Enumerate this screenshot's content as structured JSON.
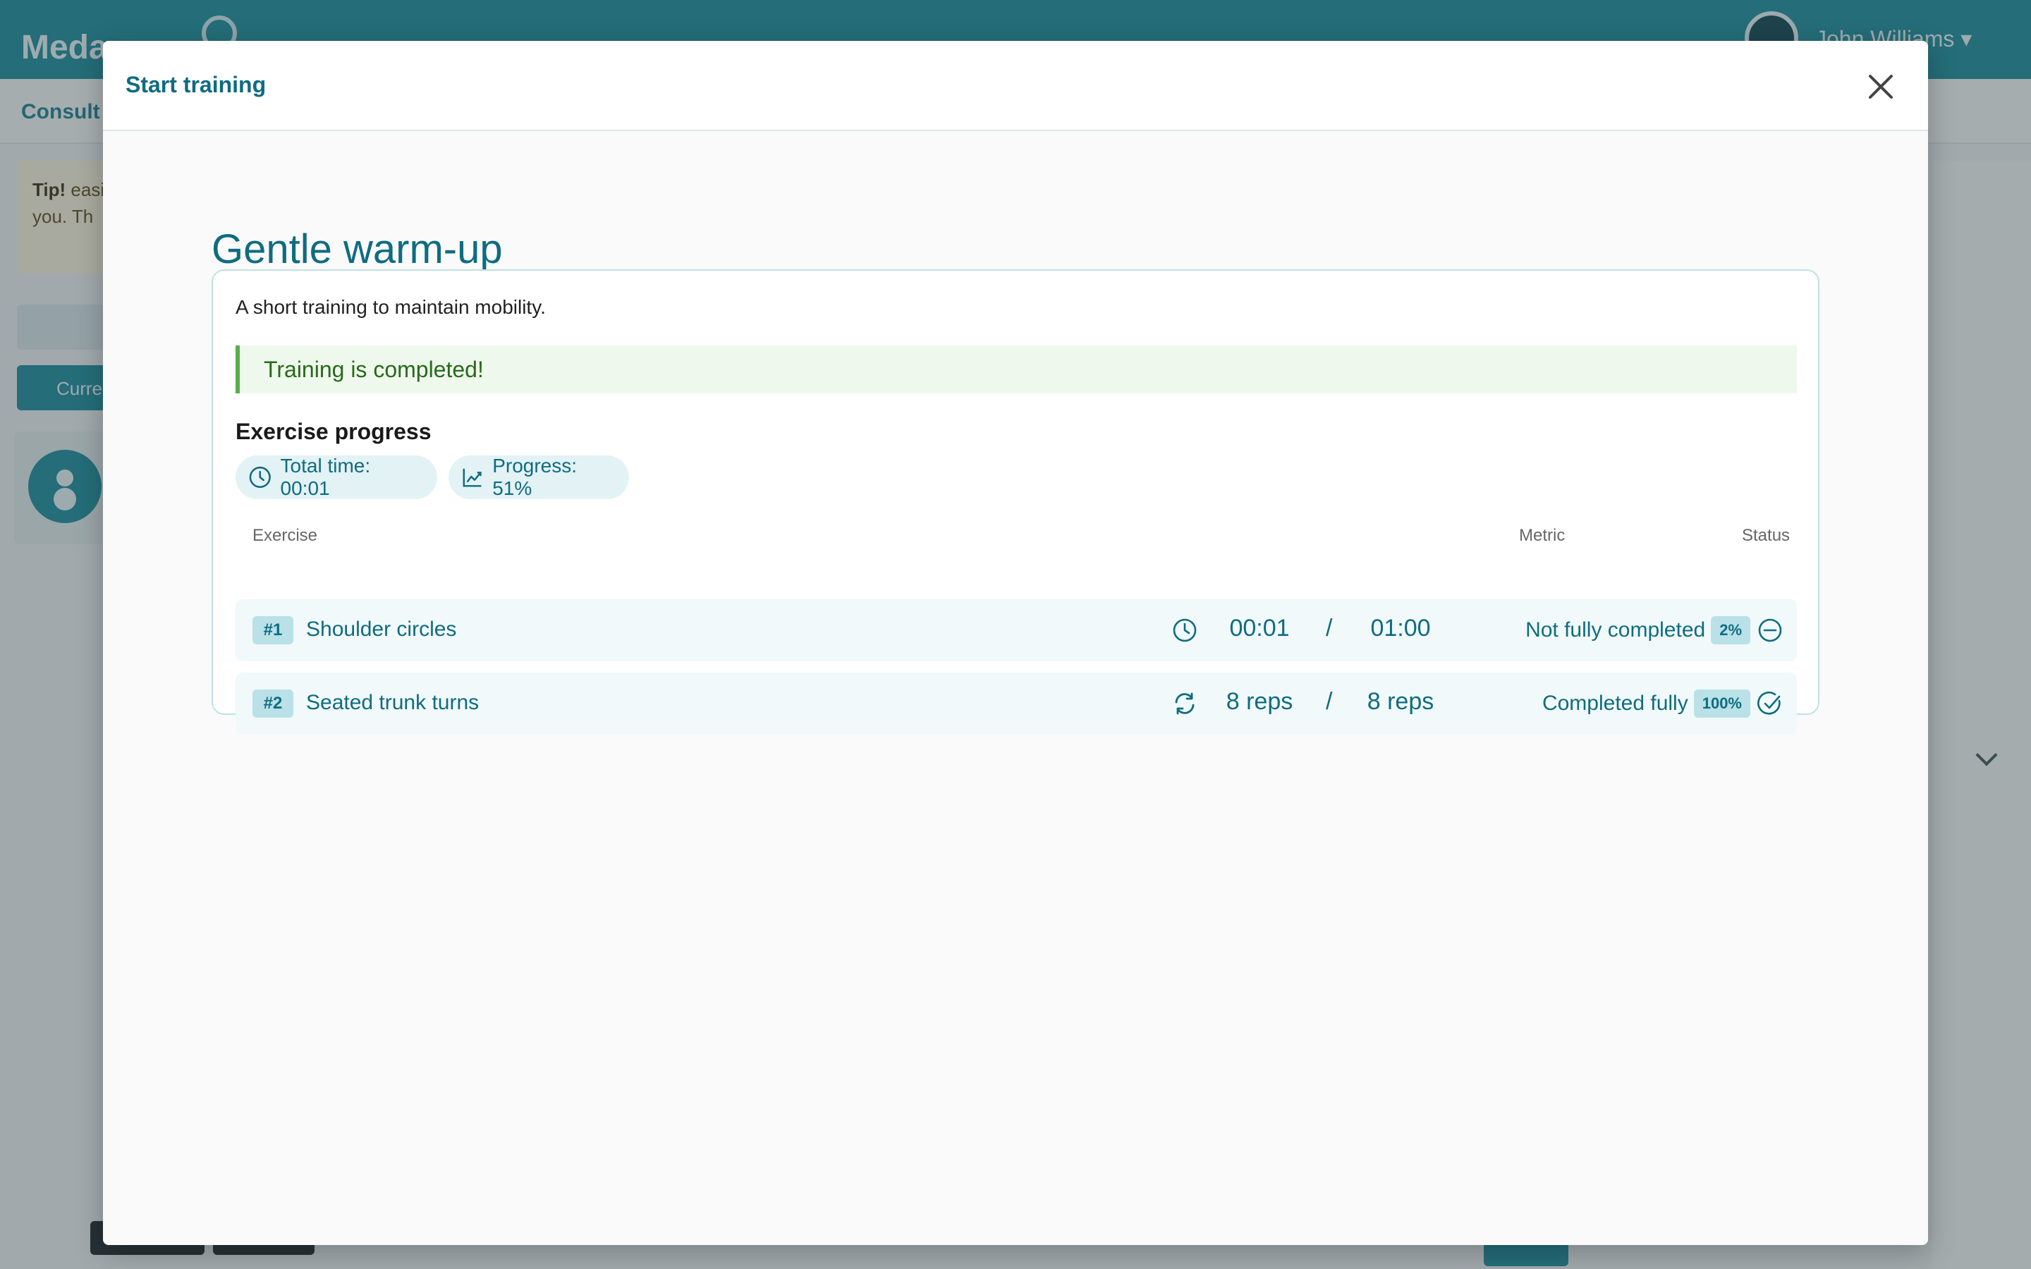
{
  "background": {
    "logo_text": "Meda",
    "user_name": "John Williams ▾",
    "subbar_text": "Consult",
    "tip_bold": "Tip!",
    "tip_text": "easier t you. Th",
    "current_button": "Curre"
  },
  "modal": {
    "header_title": "Start training",
    "close_icon": "close-icon"
  },
  "training": {
    "title": "Gentle warm-up",
    "description": "A short training to maintain mobility.",
    "alert": "Training is completed!",
    "section_title": "Exercise progress",
    "chips": {
      "total_time": "Total time: 00:01",
      "progress": "Progress: 51%"
    },
    "table": {
      "headers": {
        "exercise": "Exercise",
        "metric": "Metric",
        "status": "Status"
      },
      "rows": [
        {
          "number": "#1",
          "name": "Shoulder circles",
          "metric_icon": "clock-icon",
          "achieved": "00:01",
          "separator": "/",
          "target": "01:00",
          "status": "Not fully completed",
          "percent": "2%",
          "status_icon": "minus-circle-icon"
        },
        {
          "number": "#2",
          "name": "Seated trunk turns",
          "metric_icon": "repeat-icon",
          "achieved": "8 reps",
          "separator": "/",
          "target": "8 reps",
          "status": "Completed fully",
          "percent": "100%",
          "status_icon": "check-circle-icon"
        }
      ]
    }
  },
  "colors": {
    "primary": "#0f6c80",
    "brand_bar": "#178a9b",
    "success_border": "#5aad4c",
    "success_text": "#276a1b",
    "badge_bg": "#b9e1e7"
  }
}
